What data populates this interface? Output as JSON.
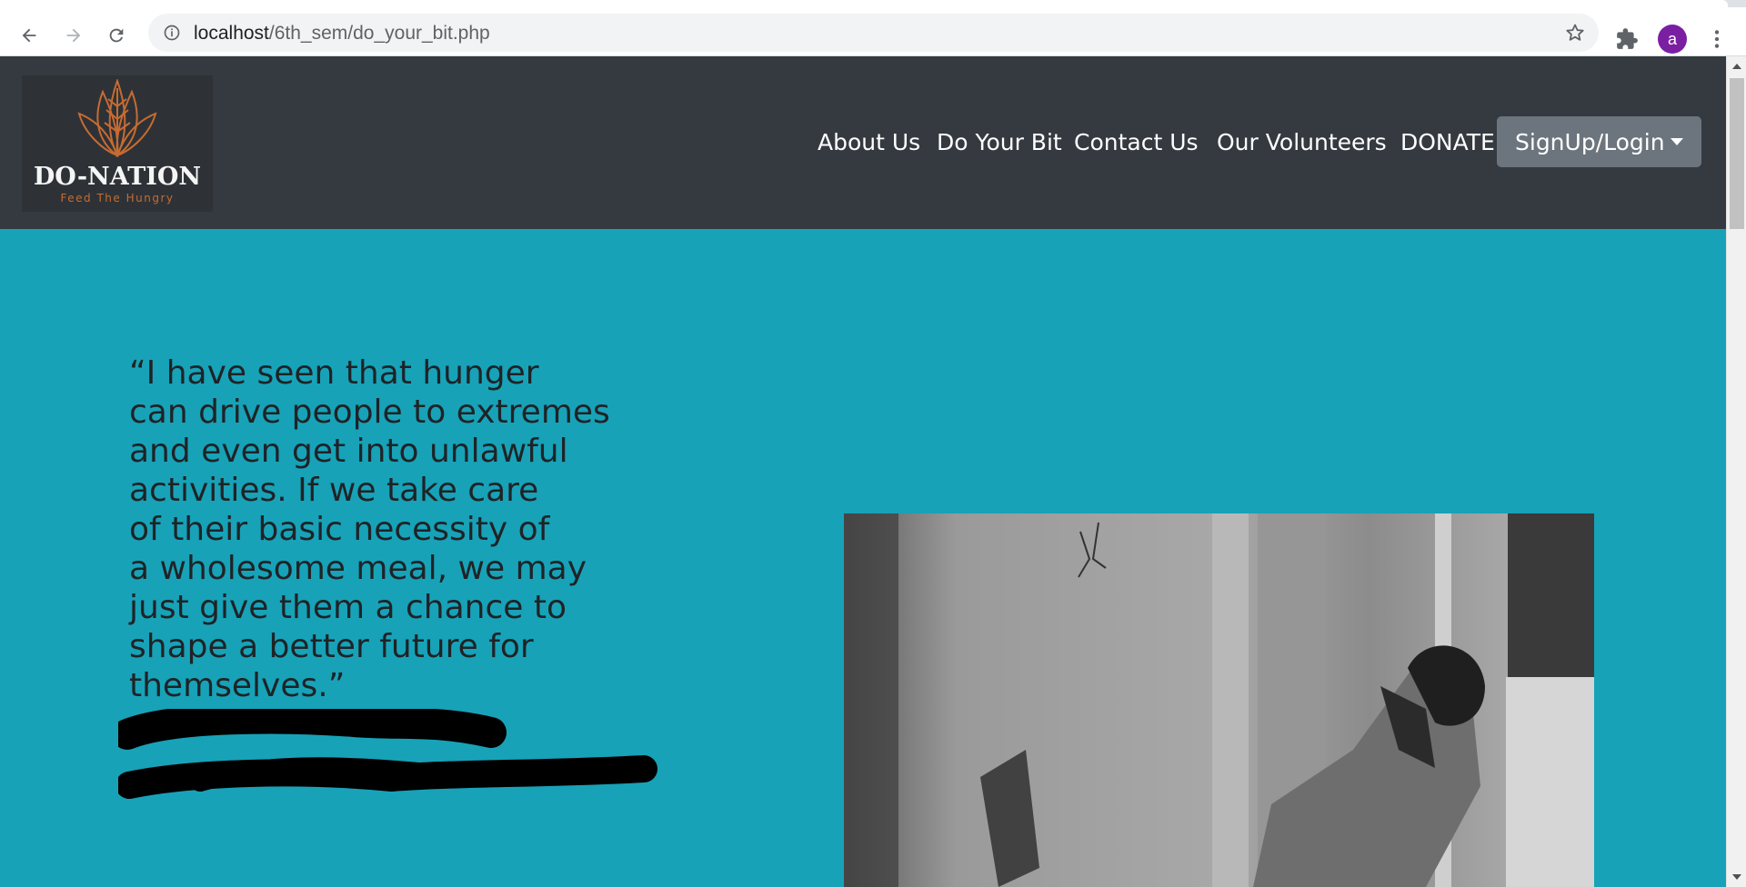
{
  "browser": {
    "url_host": "localhost",
    "url_path": "/6th_sem/do_your_bit.php",
    "profile_initial": "a",
    "profile_color": "#7b1fa2"
  },
  "site": {
    "logo_title": "DO-NATION",
    "logo_subtitle": "Feed The Hungry",
    "nav_items": [
      "About Us",
      "Do Your Bit",
      "Contact Us",
      "Our Volunteers",
      "DONATE"
    ],
    "signup_label": "SignUp/Login",
    "nav_bg": "#343a40",
    "page_bg": "#17a2b8",
    "accent": "#c66b33"
  },
  "quote": {
    "lines": [
      "“I have seen that hunger",
      "can drive people to extremes",
      "and even get into unlawful",
      "activities. If we take care",
      "of their basic necessity of",
      "a wholesome meal, we may",
      "just give them a chance to",
      "shape a better future for",
      "themselves.”"
    ]
  },
  "photo": {
    "description_icon": "photo-homeless-person"
  }
}
